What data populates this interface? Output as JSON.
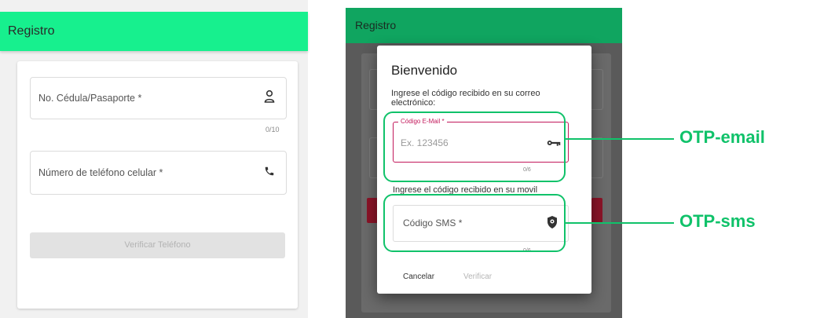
{
  "left": {
    "title": "Registro",
    "id_field": {
      "label": "No. Cédula/Pasaporte *",
      "icon": "person-icon",
      "counter": "0/10"
    },
    "phone_field": {
      "label": "Número de teléfono celular *",
      "icon": "phone-icon"
    },
    "verify_button": "Verificar Teléfono"
  },
  "right": {
    "title": "Registro",
    "dialog": {
      "title": "Bienvenido",
      "email_instruction": "Ingrese el código recibido en su correo electrónico:",
      "email_field": {
        "label": "Código E-Mail *",
        "placeholder": "Ex. 123456",
        "icon": "key-icon",
        "counter": "0/6"
      },
      "sms_instruction": "Ingrese el código recibido en su movil",
      "sms_field": {
        "label": "Código SMS *",
        "icon": "shield-icon",
        "counter": "0/6"
      },
      "cancel": "Cancelar",
      "verify": "Verificar"
    }
  },
  "callouts": {
    "email": "OTP-email",
    "sms": "OTP-sms"
  },
  "colors": {
    "appbar_light": "#17f08e",
    "appbar_dark": "#10a560",
    "error": "#c2185b",
    "highlight": "#10c26a"
  }
}
